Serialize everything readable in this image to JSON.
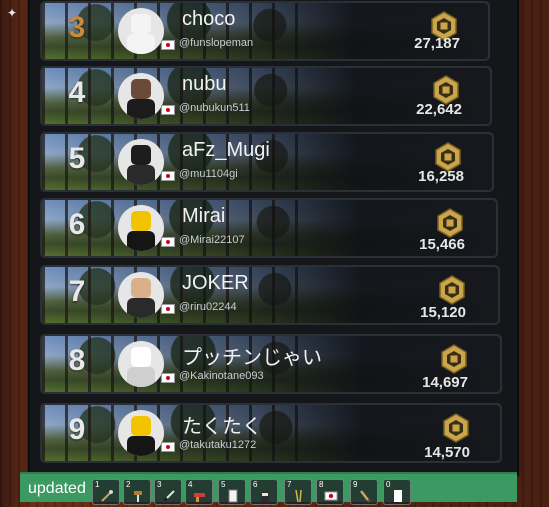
{
  "leaderboard": {
    "entries": [
      {
        "rank": "3",
        "name": "choco",
        "handle": "@funslopeman",
        "score": "27,187",
        "accent": "#c98a3a",
        "avatar_bg": "#e6e6e6",
        "avatar_head": "#f4f4f4",
        "avatar_body": "#f4f4f4"
      },
      {
        "rank": "4",
        "name": "nubu",
        "handle": "@nubukun511",
        "score": "22,642",
        "accent": "#e8e8e8",
        "avatar_bg": "#e6e6e6",
        "avatar_head": "#6b4a3a",
        "avatar_body": "#1b1b1b"
      },
      {
        "rank": "5",
        "name": "aFz_Mugi",
        "handle": "@mu1104gi",
        "score": "16,258",
        "accent": "#e8e8e8",
        "avatar_bg": "#e6e6e6",
        "avatar_head": "#1d1d1d",
        "avatar_body": "#2a2a2a"
      },
      {
        "rank": "6",
        "name": "Mirai",
        "handle": "@Mirai22107",
        "score": "15,466",
        "accent": "#e8e8e8",
        "avatar_bg": "#e6e6e6",
        "avatar_head": "#f2c400",
        "avatar_body": "#151515"
      },
      {
        "rank": "7",
        "name": "JOKER",
        "handle": "@riru02244",
        "score": "15,120",
        "accent": "#e8e8e8",
        "avatar_bg": "#e6e6e6",
        "avatar_head": "#d9b08a",
        "avatar_body": "#2a2a2a"
      },
      {
        "rank": "8",
        "name": "プッチンじゃい",
        "handle": "@Kakinotane093",
        "score": "14,697",
        "accent": "#e8e8e8",
        "avatar_bg": "#e6e6e6",
        "avatar_head": "#ffffff",
        "avatar_body": "#cfcfcf"
      },
      {
        "rank": "9",
        "name": "たくたく",
        "handle": "@takutaku1272",
        "score": "14,570",
        "accent": "#e8e8e8",
        "avatar_bg": "#e6e6e6",
        "avatar_head": "#f2c400",
        "avatar_body": "#151515"
      }
    ],
    "flag_icon": "japan-flag-icon",
    "currency_icon": "robux-coin-icon",
    "coin_color": "#c9a64a"
  },
  "hotbar": {
    "label": "updated",
    "slots": [
      {
        "num": "1",
        "icon": "sword-icon"
      },
      {
        "num": "2",
        "icon": "hammer-icon"
      },
      {
        "num": "3",
        "icon": "blade-icon"
      },
      {
        "num": "4",
        "icon": "blaster-icon"
      },
      {
        "num": "5",
        "icon": "card-icon"
      },
      {
        "num": "6",
        "icon": "cup-icon"
      },
      {
        "num": "7",
        "icon": "chopsticks-icon"
      },
      {
        "num": "8",
        "icon": "japan-flag-icon"
      },
      {
        "num": "9",
        "icon": "brush-icon"
      },
      {
        "num": "0",
        "icon": "paper-icon"
      }
    ]
  },
  "colors": {
    "board_bg": "#141619",
    "hotbar_bg": "#3a9a62"
  }
}
